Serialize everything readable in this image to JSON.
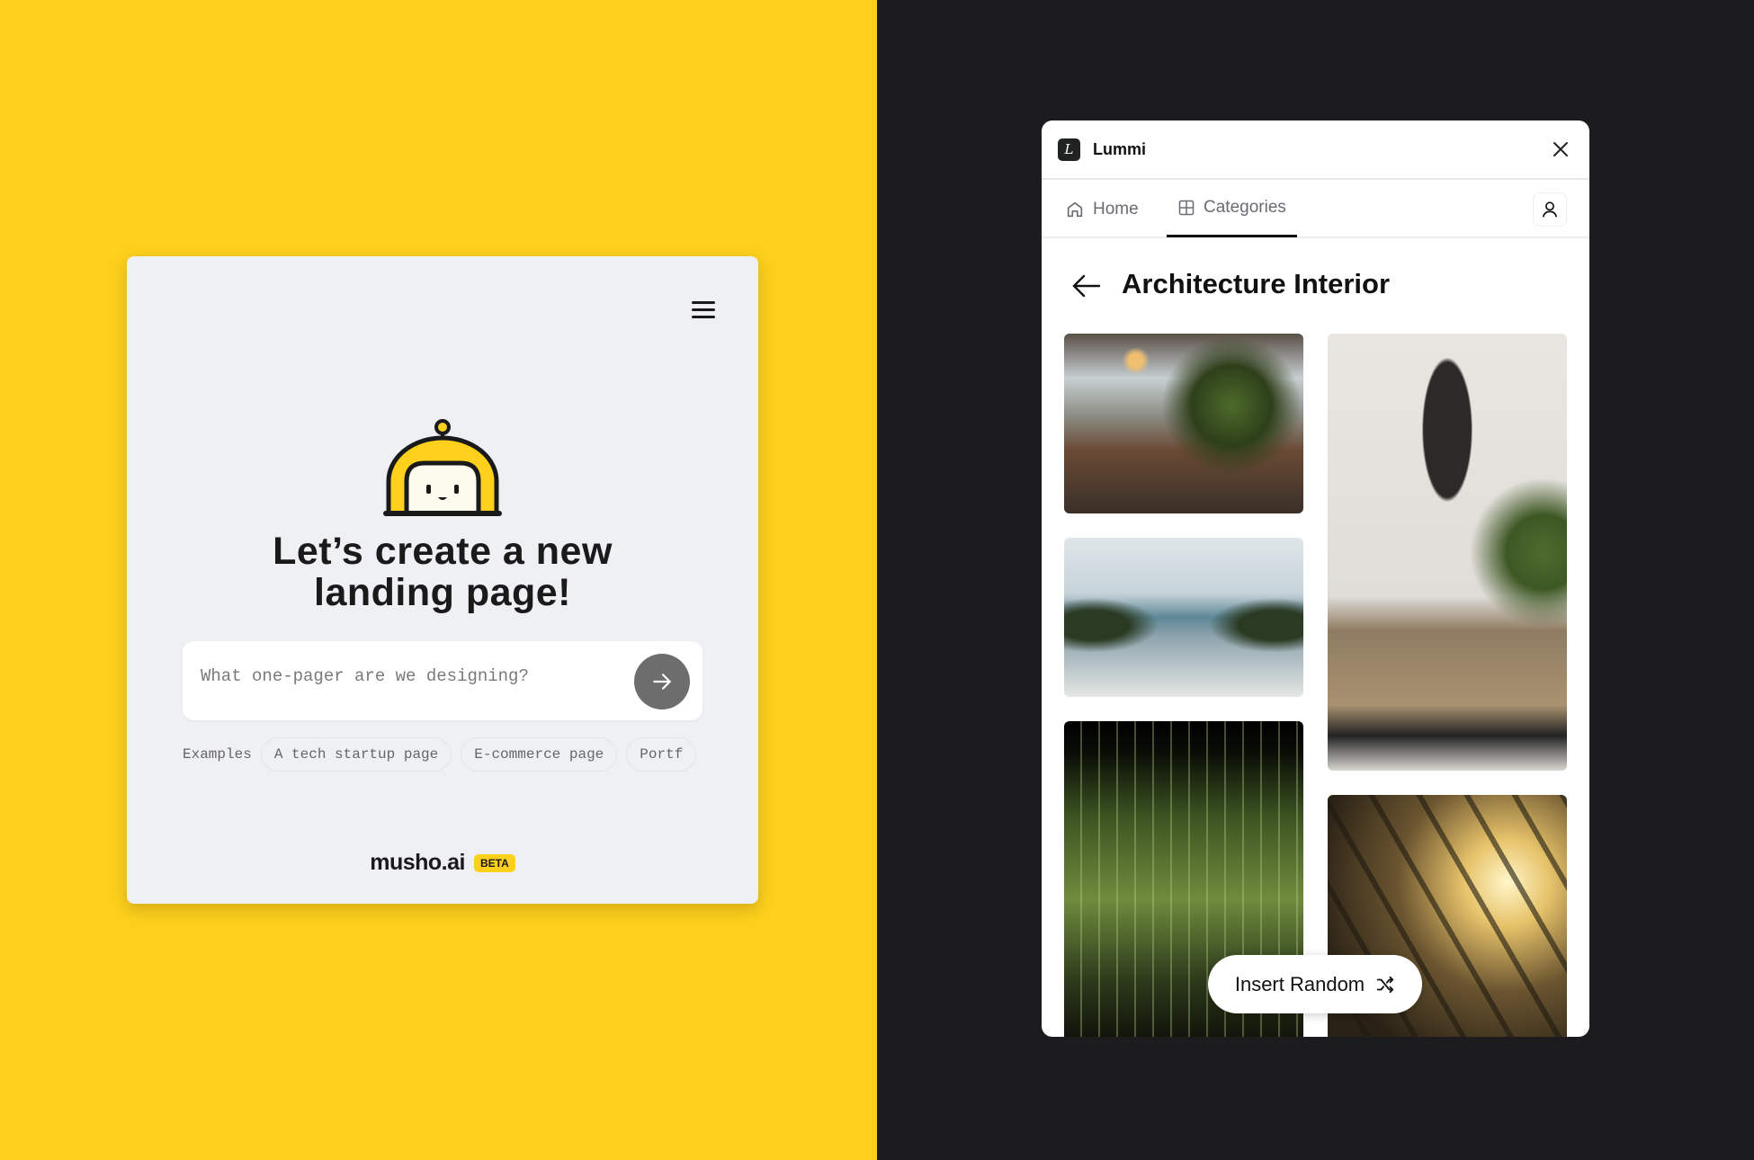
{
  "musho": {
    "heading_line1": "Let’s create a new",
    "heading_line2": "landing page!",
    "input_placeholder": "What one-pager are we designing?",
    "examples_label": "Examples",
    "examples": [
      "A tech startup page",
      "E-commerce page",
      "Portf"
    ],
    "brand": "musho.ai",
    "badge": "BETA",
    "colors": {
      "accent": "#fdd01c",
      "card": "#eff0f4"
    }
  },
  "lummi": {
    "app_title": "Lummi",
    "logo_glyph": "L",
    "tabs": [
      {
        "label": "Home",
        "icon": "home-icon"
      },
      {
        "label": "Categories",
        "icon": "grid-icon",
        "active": true
      }
    ],
    "page_title": "Architecture Interior",
    "images": [
      "office-lounge",
      "ocean-view-gym",
      "bamboo-forest-room",
      "pendant-lamp-interior",
      "sunlit-window"
    ],
    "insert_button": "Insert Random",
    "colors": {
      "background": "#1c1c1f"
    }
  }
}
